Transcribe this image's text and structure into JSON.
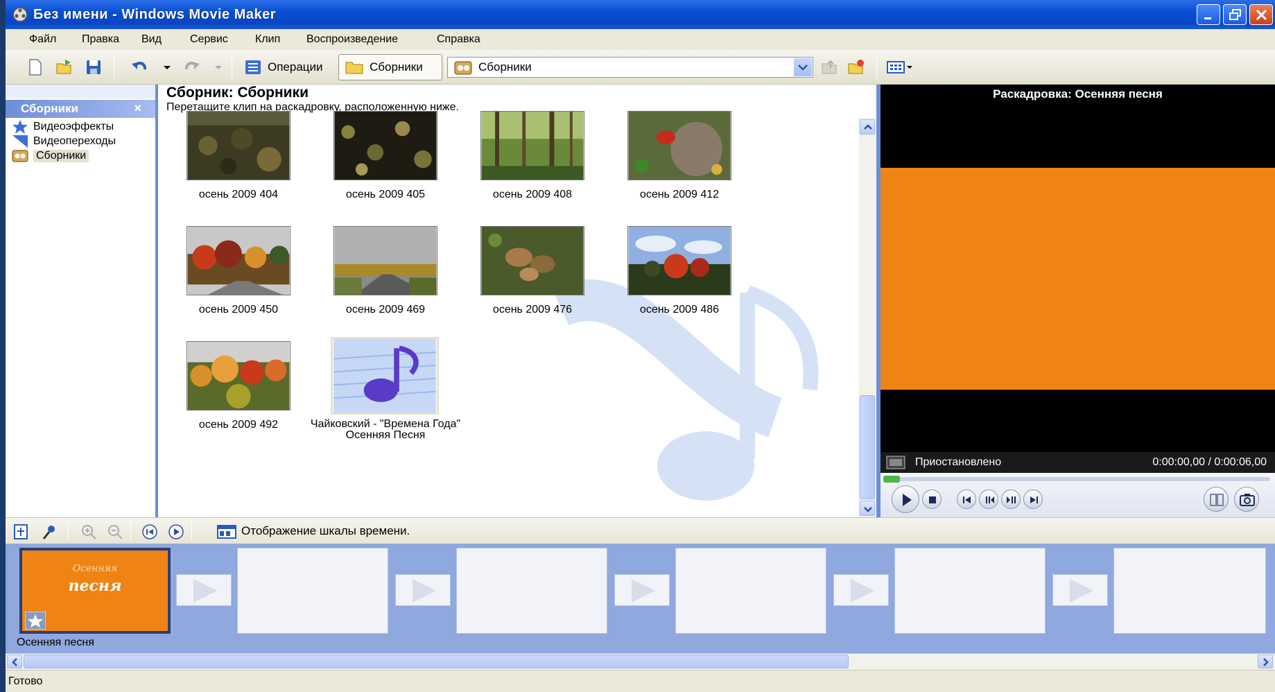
{
  "window": {
    "title": "Без имени - Windows Movie Maker"
  },
  "menu": [
    "Файл",
    "Правка",
    "Вид",
    "Сервис",
    "Клип",
    "Воспроизведение",
    "Справка"
  ],
  "toolbar": {
    "operations_label": "Операции",
    "collections_label": "Сборники",
    "combo_value": "Сборники"
  },
  "left_pane": {
    "header": "Сборники",
    "close_glyph": "×",
    "items": [
      {
        "label": "Видеоэффекты",
        "icon": "star-icon"
      },
      {
        "label": "Видеопереходы",
        "icon": "transition-icon"
      },
      {
        "label": "Сборники",
        "icon": "collection-icon"
      }
    ]
  },
  "collection": {
    "title": "Сборник: Сборники",
    "subtitle": "Перетащите клип на раскадровку, расположенную ниже.",
    "clips": [
      {
        "name": "осень 2009 404"
      },
      {
        "name": "осень 2009 405"
      },
      {
        "name": "осень 2009 408"
      },
      {
        "name": "осень 2009 412"
      },
      {
        "name": "осень 2009 450"
      },
      {
        "name": "осень 2009 469"
      },
      {
        "name": "осень 2009 476"
      },
      {
        "name": "осень 2009 486"
      },
      {
        "name": "осень 2009 492"
      },
      {
        "name": "Чайковский - \"Времена Года\" Осенняя Песня"
      }
    ]
  },
  "preview": {
    "title": "Раскадровка: Осенняя песня",
    "state": "Приостановлено",
    "time": "0:00:00,00 / 0:00:06,00",
    "progress": 0.0,
    "screen_color": "#ef8415"
  },
  "storyboard_toolbar": {
    "label": "Отображение шкалы времени."
  },
  "storyboard": {
    "first_clip_title_line1": "Осенняя",
    "first_clip_title_line2": "песня",
    "first_clip_name": "Осенняя песня"
  },
  "statusbar": {
    "text": "Готово"
  },
  "colors": {
    "accent": "#0a4fd3",
    "pane_border": "#6b8fd6",
    "storyboard_bg": "#8fa8dd",
    "orange": "#ef8415"
  }
}
